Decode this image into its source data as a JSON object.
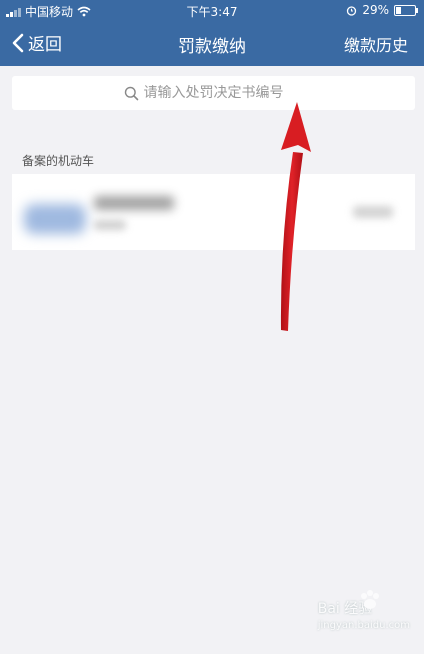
{
  "status_bar": {
    "carrier": "中国移动",
    "time": "下午3:47",
    "battery": "29%",
    "battery_level": 0.29
  },
  "nav": {
    "back_label": "返回",
    "title": "罚款缴纳",
    "history_label": "缴款历史"
  },
  "search": {
    "placeholder": "请输入处罚决定书编号",
    "value": ""
  },
  "section": {
    "label": "备案的机动车"
  },
  "watermark": {
    "main": "Bai 经验",
    "sub": "jingyan.baidu.com"
  },
  "colors": {
    "header_bg": "#3a6aa3",
    "page_bg": "#f2f2f5",
    "arrow": "#d81d22"
  }
}
